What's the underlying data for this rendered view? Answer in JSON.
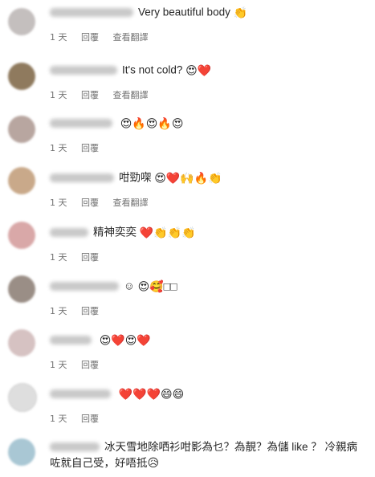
{
  "comments": [
    {
      "avatar_color": "#c4bfbe",
      "text": "Very beautiful body",
      "emoji": "👏",
      "time": "1 天",
      "reply": "回覆",
      "translate": "查看翻譯"
    },
    {
      "avatar_color": "#8f7a5e",
      "text": "It's not cold?",
      "emoji": "😍❤️",
      "time": "1 天",
      "reply": "回覆",
      "translate": "查看翻譯"
    },
    {
      "avatar_color": "#b8a6a0",
      "text": "",
      "emoji": "😍🔥😍🔥😍",
      "time": "1 天",
      "reply": "回覆"
    },
    {
      "avatar_color": "#c9a98a",
      "text": "咁勁㗎",
      "emoji": "😍❤️🙌🔥👏",
      "time": "1 天",
      "reply": "回覆",
      "translate": "查看翻譯"
    },
    {
      "avatar_color": "#d9a8a8",
      "text": "精神奕奕",
      "emoji": "❤️👏👏👏",
      "time": "1 天",
      "reply": "回覆"
    },
    {
      "avatar_color": "#9a8e86",
      "text": "☺",
      "emoji": "😍🥰□□",
      "time": "1 天",
      "reply": "回覆"
    },
    {
      "avatar_color": "#d6c2c2",
      "text": "",
      "emoji": "😍❤️😍❤️",
      "time": "1 天",
      "reply": "回覆"
    },
    {
      "avatar_color": "#dedede",
      "text": "",
      "emoji": "❤️❤️❤️😄😄",
      "time": "1 天",
      "reply": "回覆"
    },
    {
      "avatar_color": "#a9c7d4",
      "text": "冰天雪地除哂衫咁影為乜？為靚？為儲 like ？ 冷親病咗就自己受，好唔抵",
      "emoji": "😥"
    }
  ]
}
